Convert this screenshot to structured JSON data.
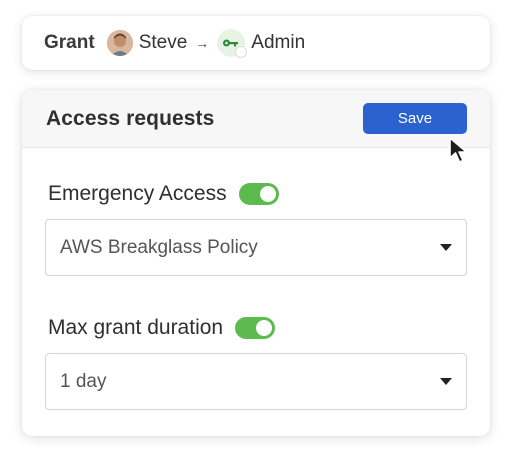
{
  "grant": {
    "label": "Grant",
    "user": "Steve",
    "arrow": "→",
    "role": "Admin"
  },
  "panel": {
    "title": "Access requests",
    "save_label": "Save"
  },
  "fields": {
    "emergency": {
      "label": "Emergency Access",
      "enabled": true,
      "value": "AWS Breakglass Policy"
    },
    "duration": {
      "label": "Max grant duration",
      "enabled": true,
      "value": "1 day"
    }
  },
  "colors": {
    "accent": "#2b62cf",
    "toggle_on": "#5cba4e"
  },
  "icons": {
    "avatar": "user-avatar",
    "role": "key-icon",
    "cursor": "mouse-pointer-icon",
    "dropdown": "chevron-down-icon"
  }
}
